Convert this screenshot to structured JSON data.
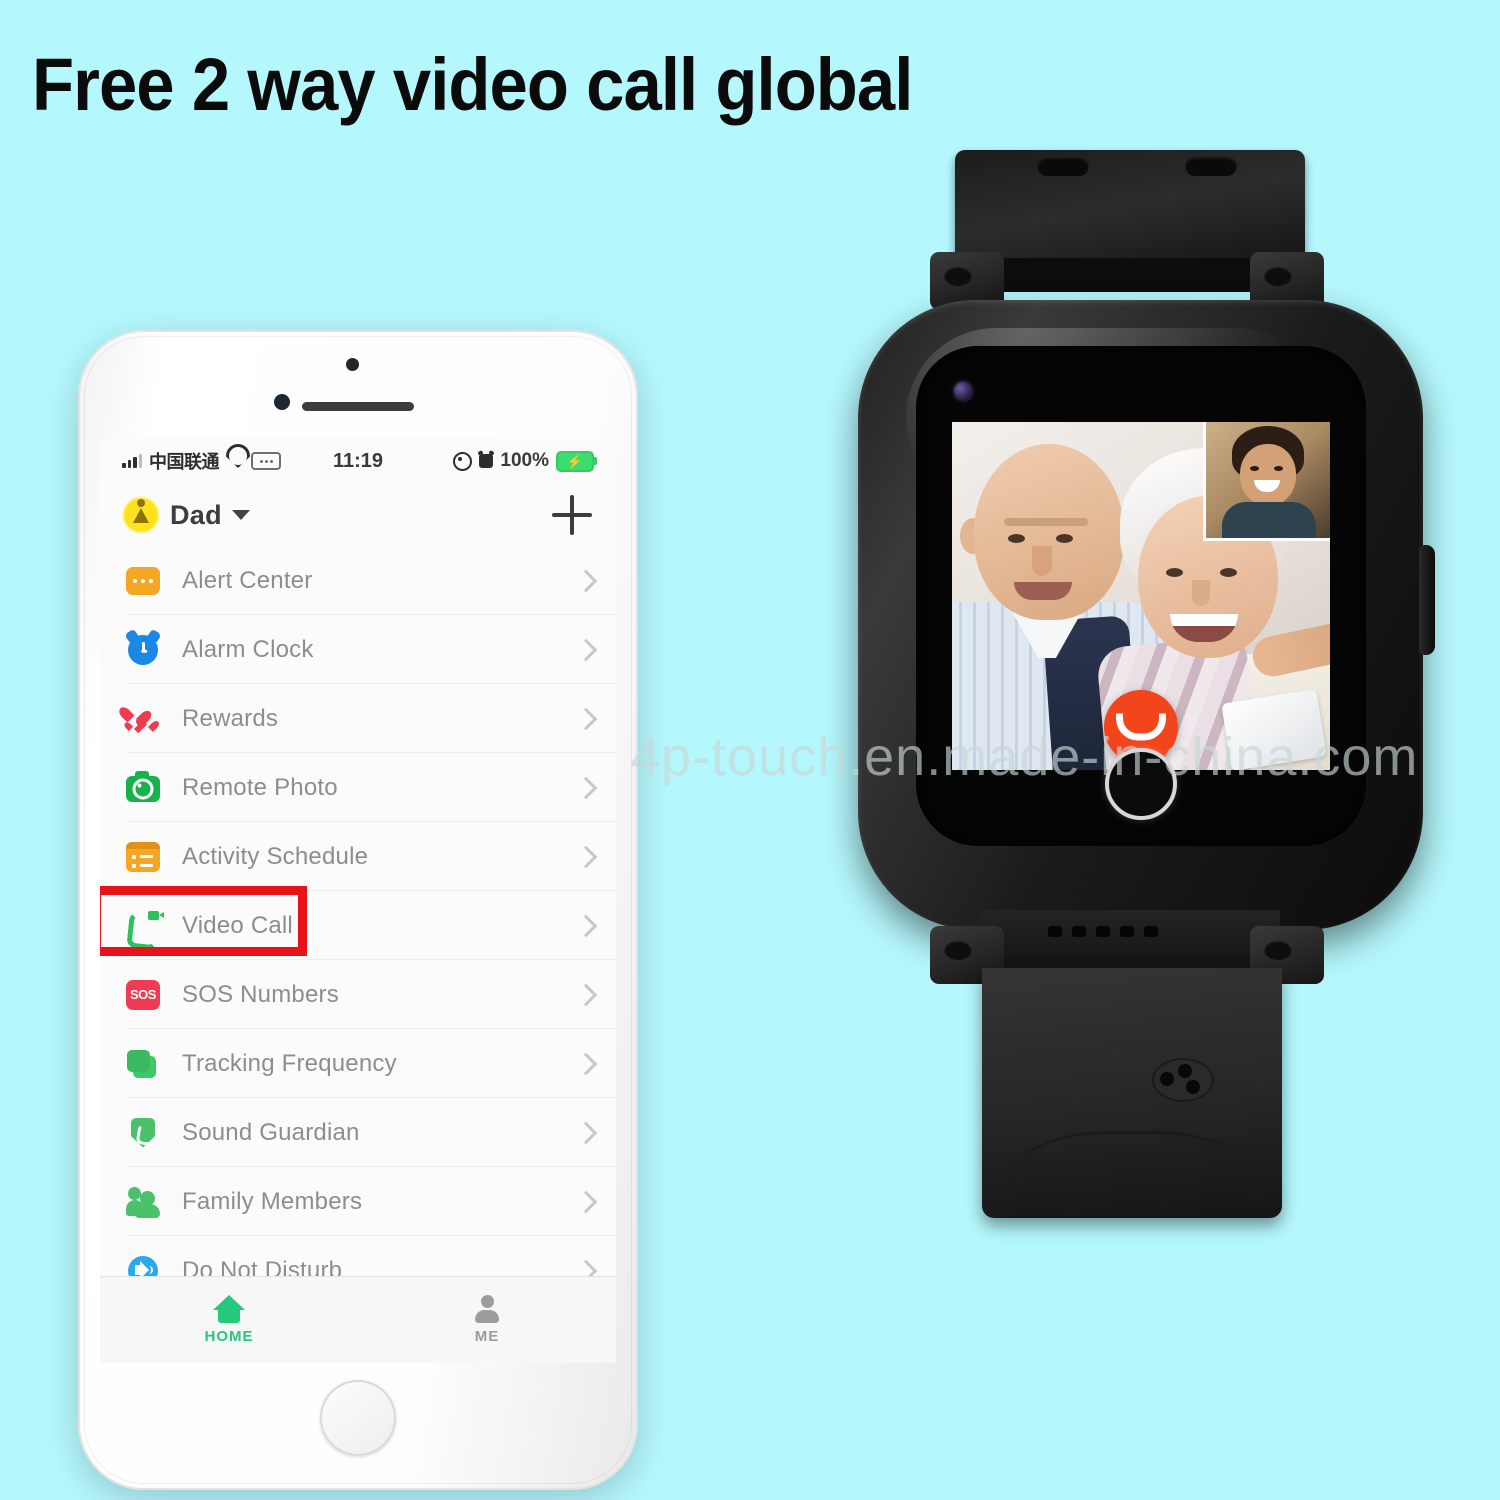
{
  "headline": "Free 2 way video call global",
  "watermark": "4p-touch.en.made-in-china.com",
  "colors": {
    "background": "#b4f7fc",
    "highlight_box": "#e8121a",
    "accent_green": "#25c97c",
    "hangup_red": "#f2451b"
  },
  "phone": {
    "status_bar": {
      "carrier": "中国联通",
      "time": "11:19",
      "battery_percent": "100%",
      "icons": [
        "signal-bars-icon",
        "wifi-icon",
        "sim-badge-icon",
        "location-icon",
        "alarm-icon",
        "battery-charging-icon"
      ]
    },
    "app_bar": {
      "profile_name": "Dad",
      "avatar": "person-badge-icon",
      "caret": "chevron-down-icon",
      "add_button": "plus-icon"
    },
    "menu_items": [
      {
        "label": "Alert Center",
        "icon": "chat-bubble-icon",
        "color": "#f5a623",
        "highlighted": false
      },
      {
        "label": "Alarm Clock",
        "icon": "alarm-clock-icon",
        "color": "#1b87e6",
        "highlighted": false
      },
      {
        "label": "Rewards",
        "icon": "hearts-icon",
        "color": "#ef3b4f",
        "highlighted": false
      },
      {
        "label": "Remote Photo",
        "icon": "camera-icon",
        "color": "#18b24a",
        "highlighted": false
      },
      {
        "label": "Activity Schedule",
        "icon": "calendar-icon",
        "color": "#f5a623",
        "highlighted": false
      },
      {
        "label": "Video Call",
        "icon": "video-phone-icon",
        "color": "#2fbf5c",
        "highlighted": true
      },
      {
        "label": "SOS Numbers",
        "icon": "sos-icon",
        "color": "#ef3b53",
        "highlighted": false
      },
      {
        "label": "Tracking Frequency",
        "icon": "stacked-cards-icon",
        "color": "#3cb85f",
        "highlighted": false
      },
      {
        "label": "Sound Guardian",
        "icon": "shield-phone-icon",
        "color": "#4cc16b",
        "highlighted": false
      },
      {
        "label": "Family Members",
        "icon": "people-icon",
        "color": "#4cc16b",
        "highlighted": false
      },
      {
        "label": "Do Not Disturb",
        "icon": "speaker-icon",
        "color": "#2aa9ef",
        "highlighted": false
      }
    ],
    "sos_text": "SOS",
    "tabs": [
      {
        "label": "HOME",
        "icon": "house-icon",
        "active": true
      },
      {
        "label": "ME",
        "icon": "person-icon",
        "active": false
      }
    ]
  },
  "watch": {
    "call_screen": {
      "main_caller": "elderly-couple-photo",
      "pip_caller": "young-man-photo",
      "hangup_button": "hangup-phone-icon"
    },
    "home_button": "watch-home-button",
    "side_button": "watch-side-button"
  }
}
